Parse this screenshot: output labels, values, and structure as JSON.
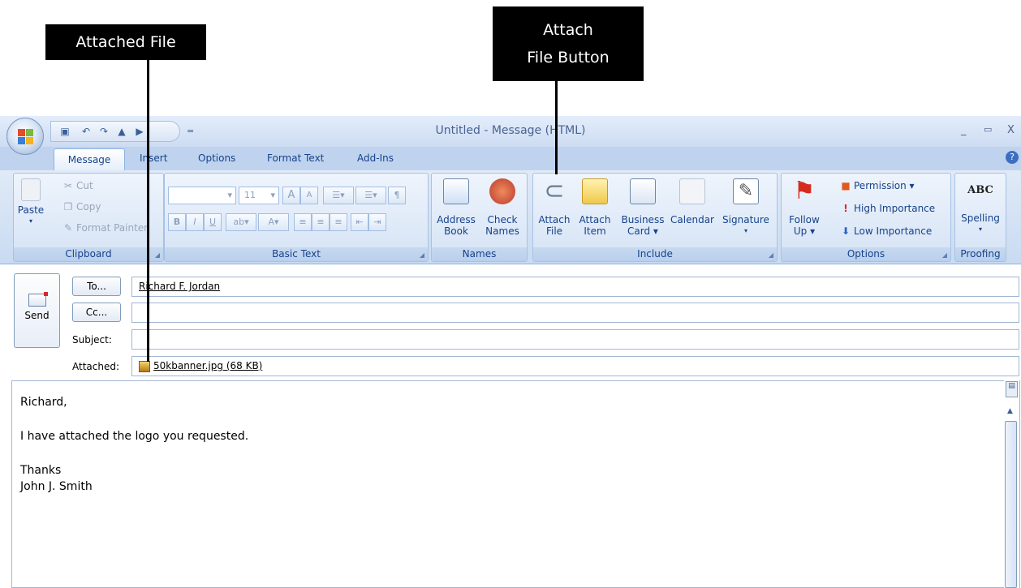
{
  "annotations": {
    "attached_file": "Attached File",
    "attach_button_line1": "Attach",
    "attach_button_line2": "File Button"
  },
  "window": {
    "title": "Untitled - Message (HTML)",
    "controls": {
      "minimize": "_",
      "maximize": "▭",
      "close": "X"
    },
    "qat_dropdown": "="
  },
  "tabs": [
    "Message",
    "Insert",
    "Options",
    "Format Text",
    "Add-Ins"
  ],
  "ribbon": {
    "clipboard": {
      "label": "Clipboard",
      "paste": "Paste",
      "cut": "Cut",
      "copy": "Copy",
      "format_painter": "Format Painter"
    },
    "basic_text": {
      "label": "Basic Text",
      "font_size": "11",
      "bold": "B",
      "italic": "I",
      "underline": "U",
      "grow_font": "A",
      "shrink_font": "A"
    },
    "names": {
      "label": "Names",
      "address_book": "Address Book",
      "address_book_l1": "Address",
      "address_book_l2": "Book",
      "check_names_l1": "Check",
      "check_names_l2": "Names"
    },
    "include": {
      "label": "Include",
      "attach_file_l1": "Attach",
      "attach_file_l2": "File",
      "attach_item_l1": "Attach",
      "attach_item_l2": "Item",
      "business_card_l1": "Business",
      "business_card_l2": "Card ▾",
      "calendar": "Calendar",
      "signature": "Signature"
    },
    "options": {
      "label": "Options",
      "follow_up_l1": "Follow",
      "follow_up_l2": "Up ▾",
      "permission": "Permission ▾",
      "high_importance": "High Importance",
      "low_importance": "Low Importance"
    },
    "proofing": {
      "label": "Proofing",
      "spelling": "Spelling",
      "abc": "ABC"
    }
  },
  "header": {
    "send_label": "Send",
    "to_button": "To...",
    "cc_button": "Cc...",
    "subject_label": "Subject:",
    "attached_label": "Attached:",
    "to_value": "Richard F. Jordan",
    "cc_value": "",
    "subject_value": "",
    "attachment": "50kbanner.jpg (68 KB)"
  },
  "body": {
    "greeting": "Richard,",
    "line1": "I have attached the logo you requested.",
    "closing": "Thanks",
    "signature": "John J. Smith"
  },
  "colors": {
    "ribbon_bg": "#c9dbf2",
    "accent_blue": "#15428b",
    "callout_bg": "#000000"
  }
}
